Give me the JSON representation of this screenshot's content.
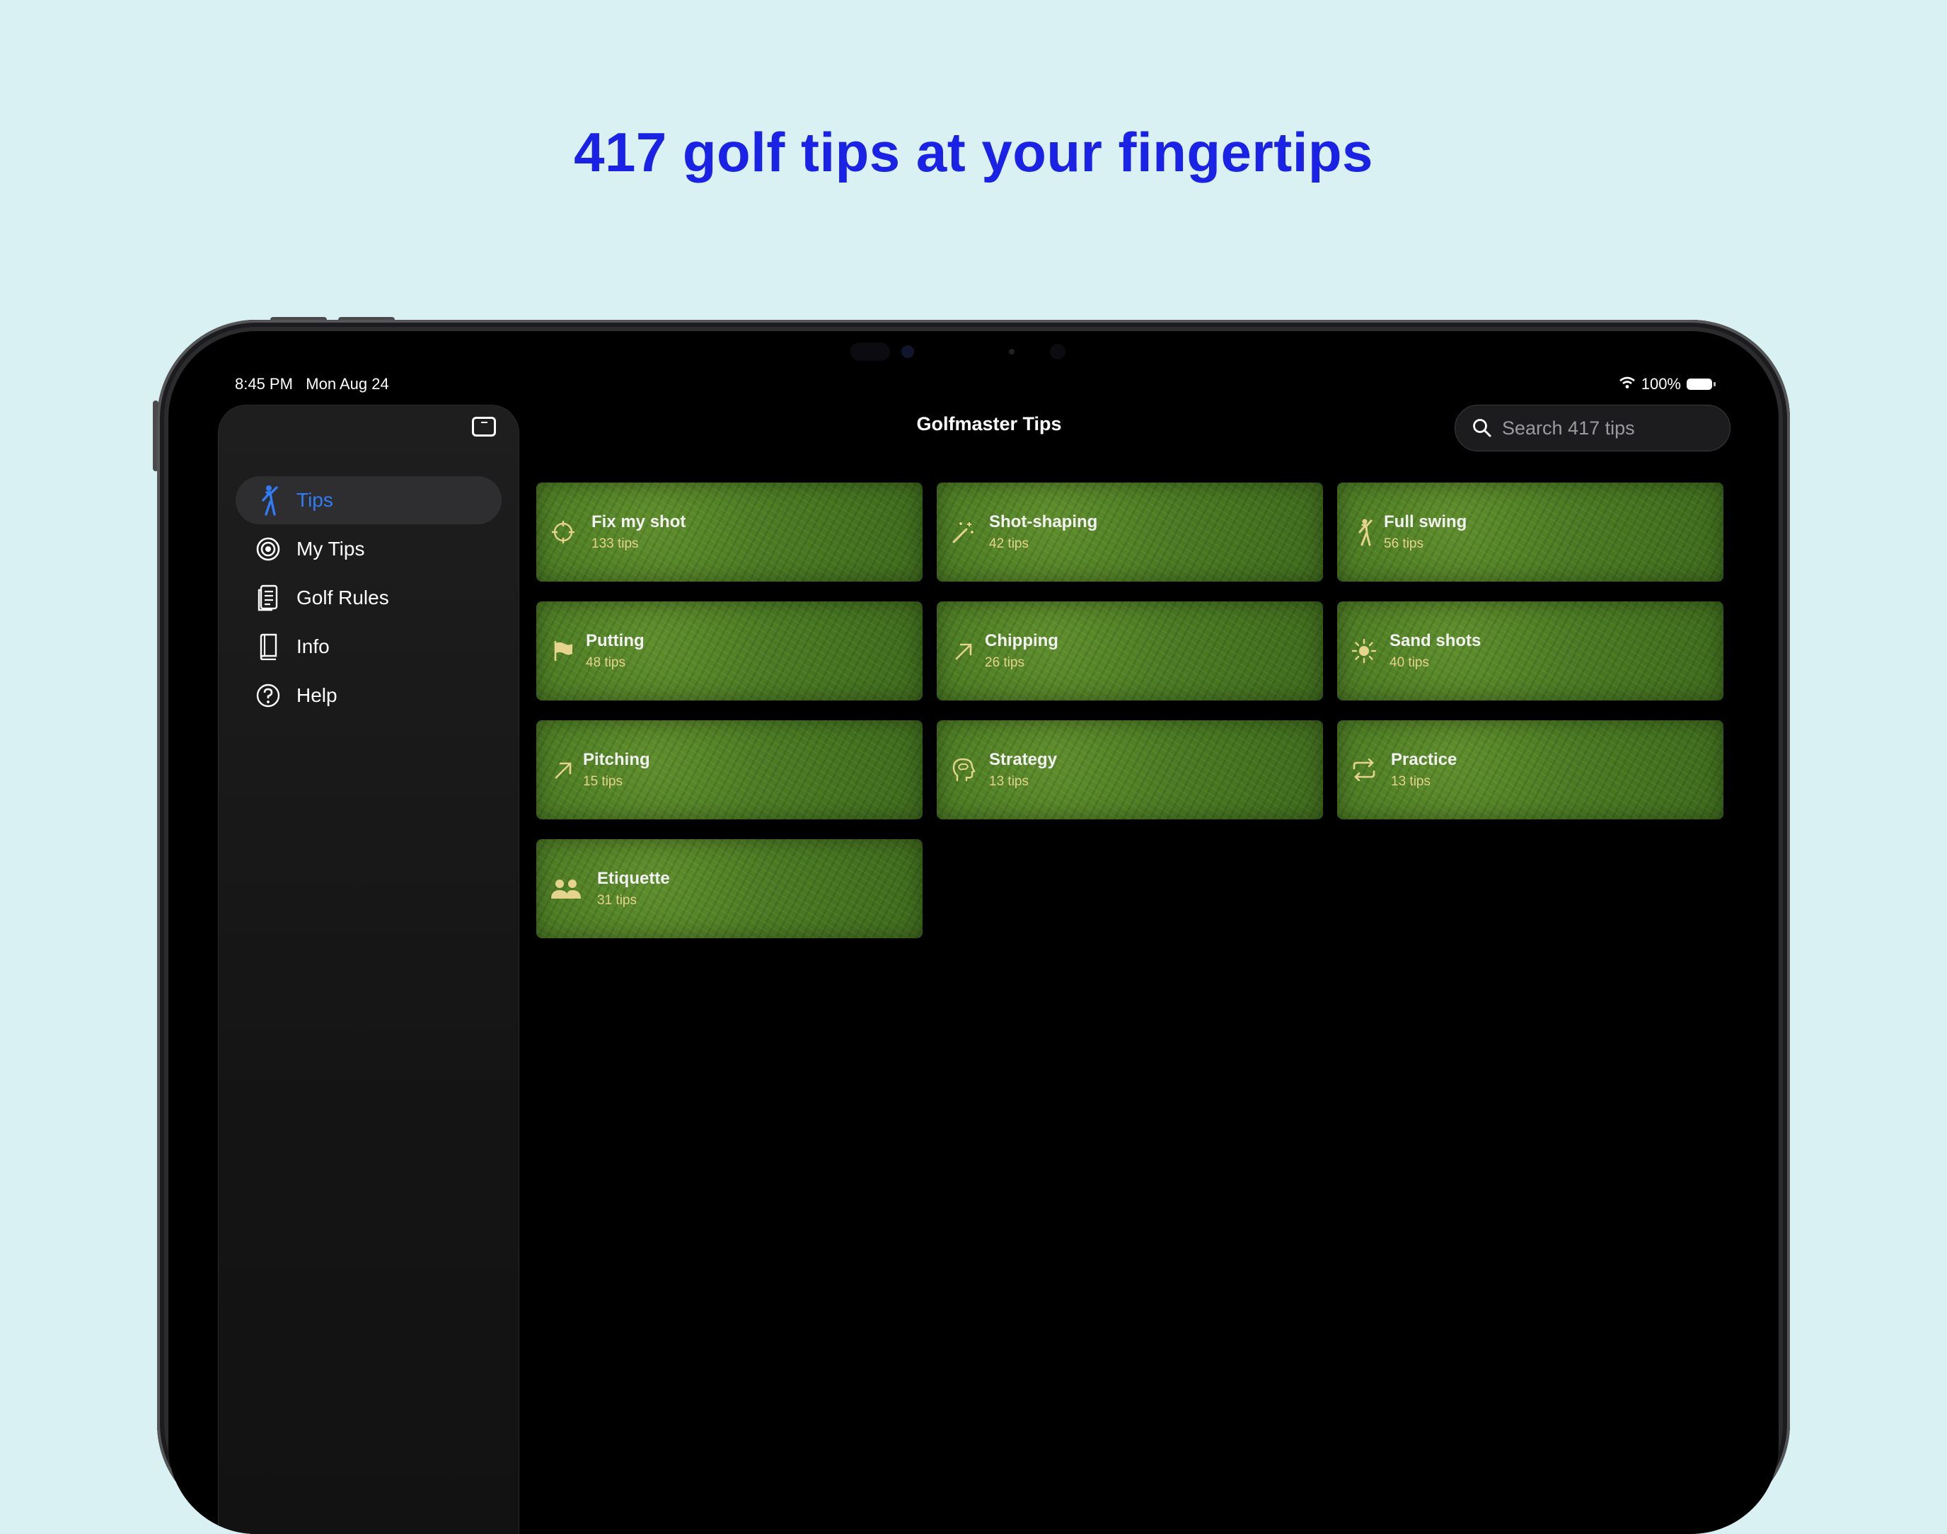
{
  "headline": "417 golf tips at your fingertips",
  "status_bar": {
    "time": "8:45 PM",
    "date": "Mon Aug 24",
    "battery": "100%"
  },
  "sidebar": {
    "items": [
      {
        "label": "Tips",
        "icon": "golfer-icon",
        "active": true
      },
      {
        "label": "My Tips",
        "icon": "target-icon"
      },
      {
        "label": "Golf Rules",
        "icon": "document-icon"
      },
      {
        "label": "Info",
        "icon": "book-icon"
      },
      {
        "label": "Help",
        "icon": "question-icon"
      }
    ]
  },
  "main": {
    "title": "Golfmaster Tips",
    "search_placeholder": "Search 417 tips",
    "categories": [
      {
        "title": "Fix my shot",
        "count": "133 tips",
        "icon": "crosshair-icon"
      },
      {
        "title": "Shot-shaping",
        "count": "42 tips",
        "icon": "magic-wand-icon"
      },
      {
        "title": "Full swing",
        "count": "56 tips",
        "icon": "golfer-icon"
      },
      {
        "title": "Putting",
        "count": "48 tips",
        "icon": "flag-icon"
      },
      {
        "title": "Chipping",
        "count": "26 tips",
        "icon": "arrow-up-right-icon"
      },
      {
        "title": "Sand shots",
        "count": "40 tips",
        "icon": "sun-icon"
      },
      {
        "title": "Pitching",
        "count": "15 tips",
        "icon": "arrow-up-right-icon"
      },
      {
        "title": "Strategy",
        "count": "13 tips",
        "icon": "brain-head-icon"
      },
      {
        "title": "Practice",
        "count": "13 tips",
        "icon": "repeat-icon"
      },
      {
        "title": "Etiquette",
        "count": "31 tips",
        "icon": "people-icon"
      }
    ]
  },
  "colors": {
    "accent": "#2f7cf6",
    "headline": "#1a22e6",
    "background": "#daf1f4",
    "count_text": "#e6d48e"
  }
}
